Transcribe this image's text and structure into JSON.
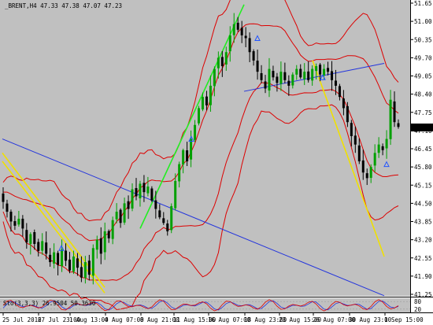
{
  "window": {
    "title": "_BRENT,H4  47.33 47.38 47.07 47.23",
    "symbol": "_BRENT,H4",
    "ohlc": [
      "47.33",
      "47.38",
      "47.07",
      "47.23"
    ]
  },
  "colors": {
    "background": "#c0c0c0",
    "axis_background": "#ffffff",
    "bull_candle": "#00a000",
    "bear_candle": "#000000",
    "bollinger": "#dd0000",
    "trend_green": "#22ee22",
    "trend_yellow": "#f0e000",
    "trend_blue": "#2233dd",
    "price_tag_bg": "#000000",
    "price_tag_text": "#ffffff",
    "arrow_marker": "#2255ff",
    "stoch_main": "#dd0000",
    "stoch_signal": "#2233dd",
    "grid": "#9a9a9a"
  },
  "chart_data": [
    {
      "type": "candlestick",
      "title": "_BRENT,H4  47.33 47.38 47.07 47.23",
      "ylim": [
        41.25,
        51.65
      ],
      "y_ticks": [
        "51.65",
        "51.00",
        "50.35",
        "49.70",
        "49.05",
        "48.40",
        "47.75",
        "47.10",
        "46.45",
        "45.80",
        "45.15",
        "44.50",
        "43.85",
        "43.20",
        "42.55",
        "41.90",
        "41.25"
      ],
      "current_price": "47.23",
      "x_ticks": [
        "25 Jul 2016",
        "27 Jul 23:00",
        "1 Aug 13:00",
        "4 Aug 07:00",
        "8 Aug 21:00",
        "11 Aug 15:00",
        "16 Aug 07:00",
        "18 Aug 23:00",
        "23 Aug 15:00",
        "26 Aug 07:00",
        "30 Aug 23:00",
        "1 Sep 15:00"
      ],
      "candles_close": [
        44.55,
        44.2,
        43.85,
        43.7,
        43.95,
        43.6,
        43.1,
        43.4,
        43.05,
        42.8,
        43.15,
        42.7,
        42.4,
        42.75,
        42.3,
        42.85,
        42.45,
        42.1,
        42.6,
        42.2,
        41.85,
        42.4,
        41.95,
        42.9,
        43.2,
        42.7,
        43.5,
        43.25,
        43.9,
        44.2,
        43.8,
        44.5,
        44.3,
        45.0,
        44.75,
        45.2,
        44.9,
        45.1,
        44.6,
        44.3,
        44.0,
        43.8,
        43.5,
        44.4,
        45.3,
        45.9,
        46.4,
        46.0,
        46.8,
        47.3,
        47.9,
        48.3,
        48.0,
        48.7,
        49.3,
        49.7,
        49.4,
        49.9,
        50.5,
        50.9,
        50.7,
        50.5,
        50.4,
        49.9,
        49.6,
        49.2,
        48.9,
        48.6,
        49.3,
        49.0,
        48.8,
        49.2,
        48.9,
        48.7,
        49.1,
        49.3,
        49.0,
        49.2,
        48.9,
        49.3,
        49.4,
        49.1,
        49.3,
        49.2,
        48.9,
        48.7,
        48.3,
        47.9,
        47.4,
        46.9,
        46.6,
        46.0,
        45.6,
        45.4,
        45.8,
        46.3,
        46.6,
        46.4,
        46.8,
        48.2,
        47.4,
        47.23
      ],
      "trendlines": [
        {
          "color": "green",
          "from": [
            "8 Aug 21:00",
            43.6
          ],
          "to": [
            "18 Aug 23:00",
            51.6
          ]
        },
        {
          "color": "yellow",
          "from": [
            "25 Jul 2016",
            46.0
          ],
          "to": [
            "4 Aug 07:00",
            41.3
          ]
        },
        {
          "color": "yellow",
          "from": [
            "25 Jul 2016",
            46.3
          ],
          "to": [
            "4 Aug 07:00",
            41.5
          ]
        },
        {
          "color": "yellow",
          "from": [
            "26 Aug 07:00",
            49.6
          ],
          "to": [
            "1 Sep 15:00",
            42.6
          ]
        },
        {
          "color": "blue",
          "from": [
            "25 Jul 2016",
            46.8
          ],
          "to": [
            "1 Sep 15:00",
            41.2
          ]
        },
        {
          "color": "blue",
          "from": [
            "18 Aug 23:00",
            48.5
          ],
          "to": [
            "1 Sep 15:00",
            49.5
          ]
        }
      ],
      "indicators": [
        "Bollinger Bands (inner)",
        "Bollinger Bands (outer)"
      ]
    },
    {
      "type": "line",
      "title": "Sto(3,3,3) 26.9504 50.3630",
      "label": "Sto(3,3,3) 26.9504 50.3630",
      "y_ticks": [
        "80",
        "20"
      ],
      "ylim": [
        0,
        100
      ]
    }
  ]
}
